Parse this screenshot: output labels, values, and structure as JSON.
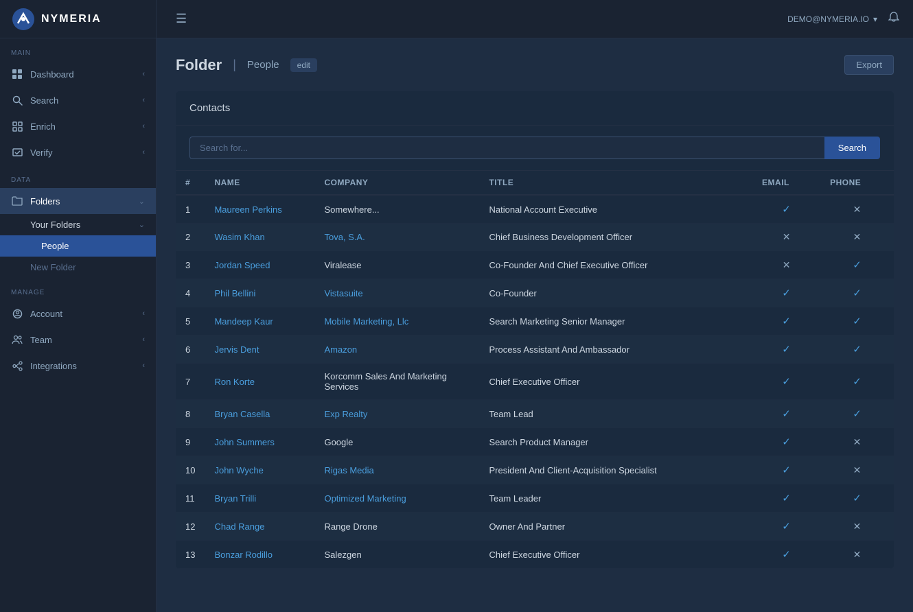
{
  "app": {
    "name": "NYMERIA"
  },
  "topbar": {
    "account_label": "DEMO@NYMERIA.IO",
    "account_chevron": "▾"
  },
  "sidebar": {
    "sections": [
      {
        "label": "MAIN",
        "items": [
          {
            "id": "dashboard",
            "label": "Dashboard",
            "icon": "◉",
            "hasArrow": true
          },
          {
            "id": "search",
            "label": "Search",
            "icon": "🔍",
            "hasArrow": true,
            "active": false
          },
          {
            "id": "enrich",
            "label": "Enrich",
            "icon": "⊞",
            "hasArrow": true
          },
          {
            "id": "verify",
            "label": "Verify",
            "icon": "☑",
            "hasArrow": true
          }
        ]
      },
      {
        "label": "DATA",
        "items": [
          {
            "id": "folders",
            "label": "Folders",
            "icon": "📁",
            "hasArrow": true,
            "active": true,
            "expanded": true
          }
        ],
        "subItems": [
          {
            "id": "your-folders",
            "label": "Your Folders",
            "active": true,
            "expanded": true
          },
          {
            "id": "people",
            "label": "People",
            "activeLevel": 2
          },
          {
            "id": "new-folder",
            "label": "New Folder",
            "isNew": true
          }
        ]
      },
      {
        "label": "MANAGE",
        "items": [
          {
            "id": "account",
            "label": "Account",
            "icon": "⚙",
            "hasArrow": true
          },
          {
            "id": "team",
            "label": "Team",
            "icon": "👤",
            "hasArrow": true
          },
          {
            "id": "integrations",
            "label": "Integrations",
            "icon": "🔗",
            "hasArrow": true
          }
        ]
      }
    ]
  },
  "page": {
    "folder_label": "Folder",
    "people_label": "People",
    "edit_label": "edit",
    "export_label": "Export"
  },
  "contacts": {
    "section_title": "Contacts",
    "search_placeholder": "Search for...",
    "search_button": "Search",
    "table": {
      "columns": [
        "#",
        "Name",
        "Company",
        "Title",
        "Email",
        "Phone"
      ],
      "rows": [
        {
          "num": 1,
          "name": "Maureen Perkins",
          "company": "Somewhere...",
          "company_link": false,
          "title": "National Account Executive",
          "email": "check",
          "phone": "x"
        },
        {
          "num": 2,
          "name": "Wasim Khan",
          "company": "Tova, S.A.",
          "company_link": true,
          "title": "Chief Business Development Officer",
          "email": "x",
          "phone": "x"
        },
        {
          "num": 3,
          "name": "Jordan Speed",
          "company": "Viralease",
          "company_link": false,
          "title": "Co-Founder And Chief Executive Officer",
          "email": "x",
          "phone": "check"
        },
        {
          "num": 4,
          "name": "Phil Bellini",
          "company": "Vistasuite",
          "company_link": true,
          "title": "Co-Founder",
          "email": "check",
          "phone": "check"
        },
        {
          "num": 5,
          "name": "Mandeep Kaur",
          "company": "Mobile Marketing, Llc",
          "company_link": true,
          "title": "Search Marketing Senior Manager",
          "email": "check",
          "phone": "check"
        },
        {
          "num": 6,
          "name": "Jervis Dent",
          "company": "Amazon",
          "company_link": true,
          "title": "Process Assistant And Ambassador",
          "email": "check",
          "phone": "check"
        },
        {
          "num": 7,
          "name": "Ron Korte",
          "company": "Korcomm Sales And Marketing Services",
          "company_link": false,
          "title": "Chief Executive Officer",
          "email": "check",
          "phone": "check"
        },
        {
          "num": 8,
          "name": "Bryan Casella",
          "company": "Exp Realty",
          "company_link": true,
          "title": "Team Lead",
          "email": "check",
          "phone": "check"
        },
        {
          "num": 9,
          "name": "John Summers",
          "company": "Google",
          "company_link": false,
          "title": "Search Product Manager",
          "email": "check",
          "phone": "x"
        },
        {
          "num": 10,
          "name": "John Wyche",
          "company": "Rigas Media",
          "company_link": true,
          "title": "President And Client-Acquisition Specialist",
          "email": "check",
          "phone": "x"
        },
        {
          "num": 11,
          "name": "Bryan Trilli",
          "company": "Optimized Marketing",
          "company_link": true,
          "title": "Team Leader",
          "email": "check",
          "phone": "check"
        },
        {
          "num": 12,
          "name": "Chad Range",
          "company": "Range Drone",
          "company_link": false,
          "title": "Owner And Partner",
          "email": "check",
          "phone": "x"
        },
        {
          "num": 13,
          "name": "Bonzar Rodillo",
          "company": "Salezgen",
          "company_link": false,
          "title": "Chief Executive Officer",
          "email": "check",
          "phone": "x"
        }
      ]
    }
  }
}
